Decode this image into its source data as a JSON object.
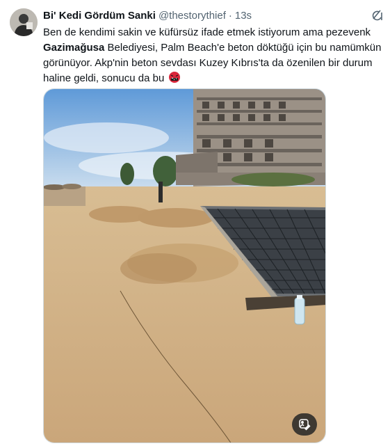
{
  "tweet": {
    "author_name": "Bi' Kedi Gördüm Sanki",
    "handle": "@thestorythief",
    "separator": "·",
    "time": "13s",
    "text_part1": "Ben de kendimi sakin ve küfürsüz ifade etmek istiyorum ama pezevenk ",
    "text_bold": "Gazimağusa",
    "text_part2": " Belediyesi, Palm Beach'e beton döktüğü için bu namümkün görünüyor. Akp'nin beton sevdası Kuzey Kıbrıs'ta da özenilen bir durum haline geldi, sonucu da bu",
    "emoji_icon": "angry-face-symbols-icon"
  },
  "icons": {
    "grok": "grok-icon",
    "alt_button": "image-edit-icon"
  },
  "colors": {
    "text": "#0f1419",
    "muted": "#536471",
    "sand": "#d8b98c",
    "sky": "#7fb3e6"
  }
}
